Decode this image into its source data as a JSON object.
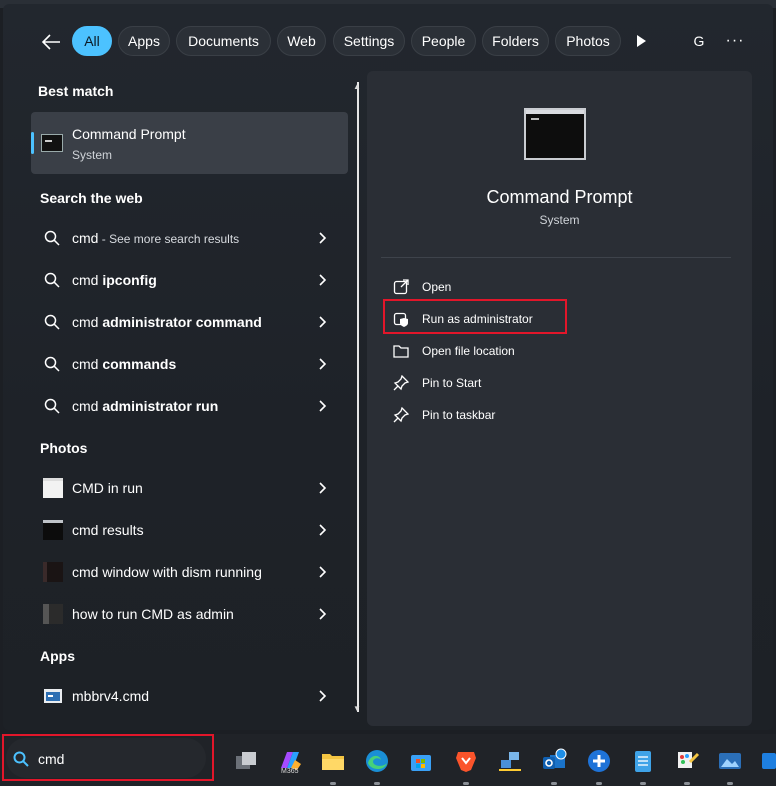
{
  "filters": {
    "back_icon": "arrow-left-icon",
    "chips": [
      "All",
      "Apps",
      "Documents",
      "Web",
      "Settings",
      "People",
      "Folders",
      "Photos"
    ],
    "active": "All",
    "avatar_letter": "G",
    "more_label": "···"
  },
  "left": {
    "best_match_heading": "Best match",
    "best_match": {
      "title": "Command Prompt",
      "subtitle": "System"
    },
    "web_heading": "Search the web",
    "web_items": [
      {
        "prefix": "cmd",
        "bold": "",
        "hint": " - See more search results"
      },
      {
        "prefix": "cmd ",
        "bold": "ipconfig",
        "hint": ""
      },
      {
        "prefix": "cmd ",
        "bold": "administrator command",
        "hint": ""
      },
      {
        "prefix": "cmd ",
        "bold": "commands",
        "hint": ""
      },
      {
        "prefix": "cmd ",
        "bold": "administrator run",
        "hint": ""
      }
    ],
    "photos_heading": "Photos",
    "photo_items": [
      "CMD in run",
      "cmd results",
      "cmd window with dism running",
      "how to run CMD as admin"
    ],
    "apps_heading": "Apps",
    "app_items": [
      "mbbrv4.cmd"
    ]
  },
  "right": {
    "title": "Command Prompt",
    "subtitle": "System",
    "actions": [
      {
        "label": "Open",
        "icon": "open-external-icon"
      },
      {
        "label": "Run as administrator",
        "icon": "shield-icon"
      },
      {
        "label": "Open file location",
        "icon": "folder-icon"
      },
      {
        "label": "Pin to Start",
        "icon": "pin-icon"
      },
      {
        "label": "Pin to taskbar",
        "icon": "pin-icon"
      }
    ]
  },
  "taskbar": {
    "search_value": "cmd",
    "m365_label": "M365",
    "apps": [
      "task-view",
      "microsoft-365",
      "file-explorer",
      "edge",
      "store",
      "brave",
      "network",
      "outlook",
      "app-plus",
      "notepad",
      "paint",
      "photos",
      "app-last"
    ]
  },
  "colors": {
    "accent": "#4cc2ff",
    "highlight": "#e2162a"
  }
}
